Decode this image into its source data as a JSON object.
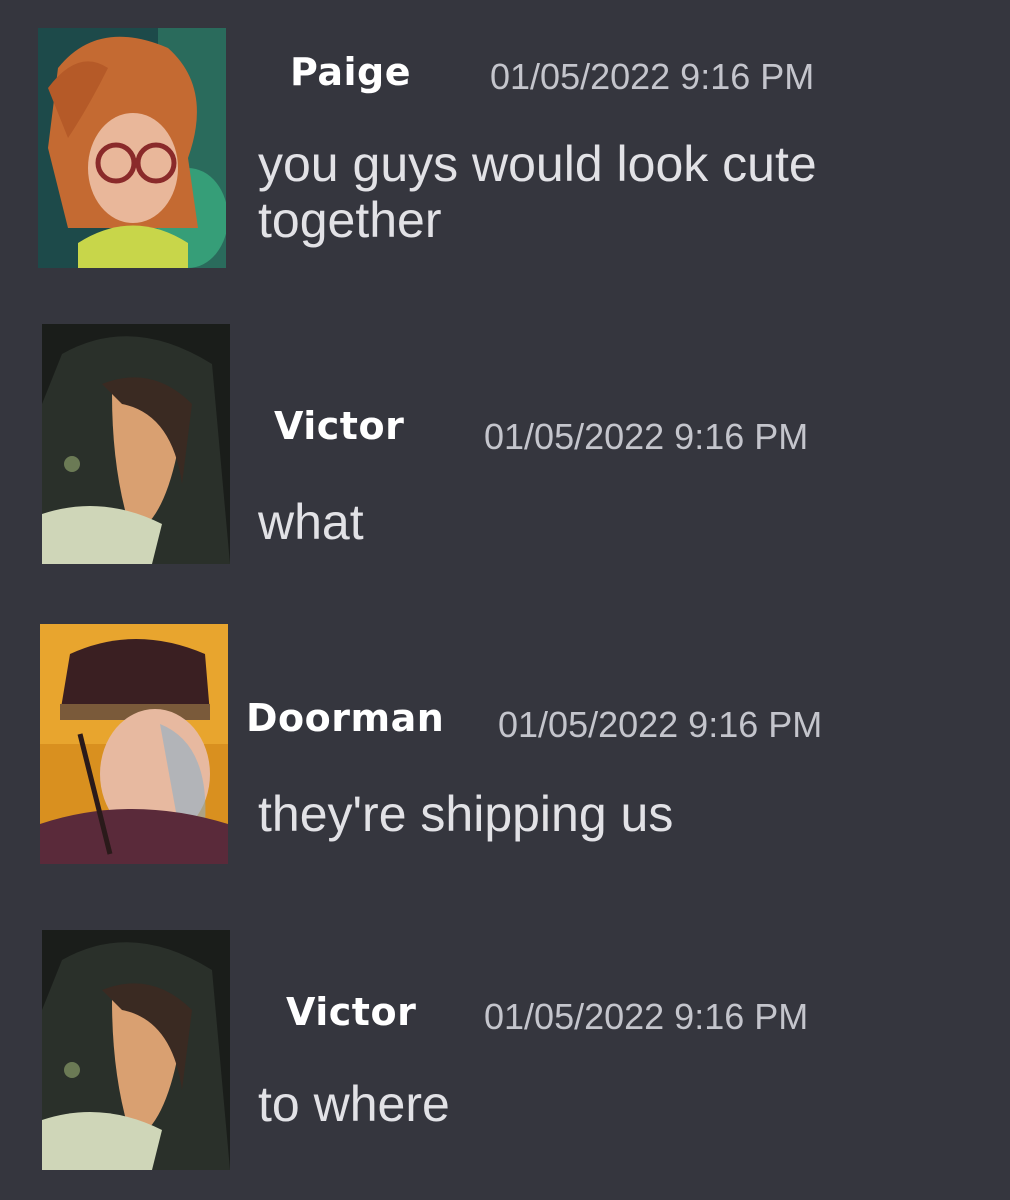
{
  "messages": [
    {
      "author": "Paige",
      "timestamp": "01/05/2022 9:16 PM",
      "lines": [
        "you guys would look cute",
        "together"
      ],
      "avatar_icon": "paige-avatar"
    },
    {
      "author": "Victor",
      "timestamp": "01/05/2022 9:16 PM",
      "lines": [
        "what"
      ],
      "avatar_icon": "victor-avatar"
    },
    {
      "author": "Doorman",
      "timestamp": "01/05/2022 9:16 PM",
      "lines": [
        "they're shipping us"
      ],
      "avatar_icon": "doorman-avatar"
    },
    {
      "author": "Victor",
      "timestamp": "01/05/2022 9:16 PM",
      "lines": [
        "to where"
      ],
      "avatar_icon": "victor-avatar"
    }
  ],
  "colors": {
    "background": "#35363e",
    "username": "#ffffff",
    "timestamp": "#c4c5cc",
    "message_text": "#e2e2e6"
  }
}
